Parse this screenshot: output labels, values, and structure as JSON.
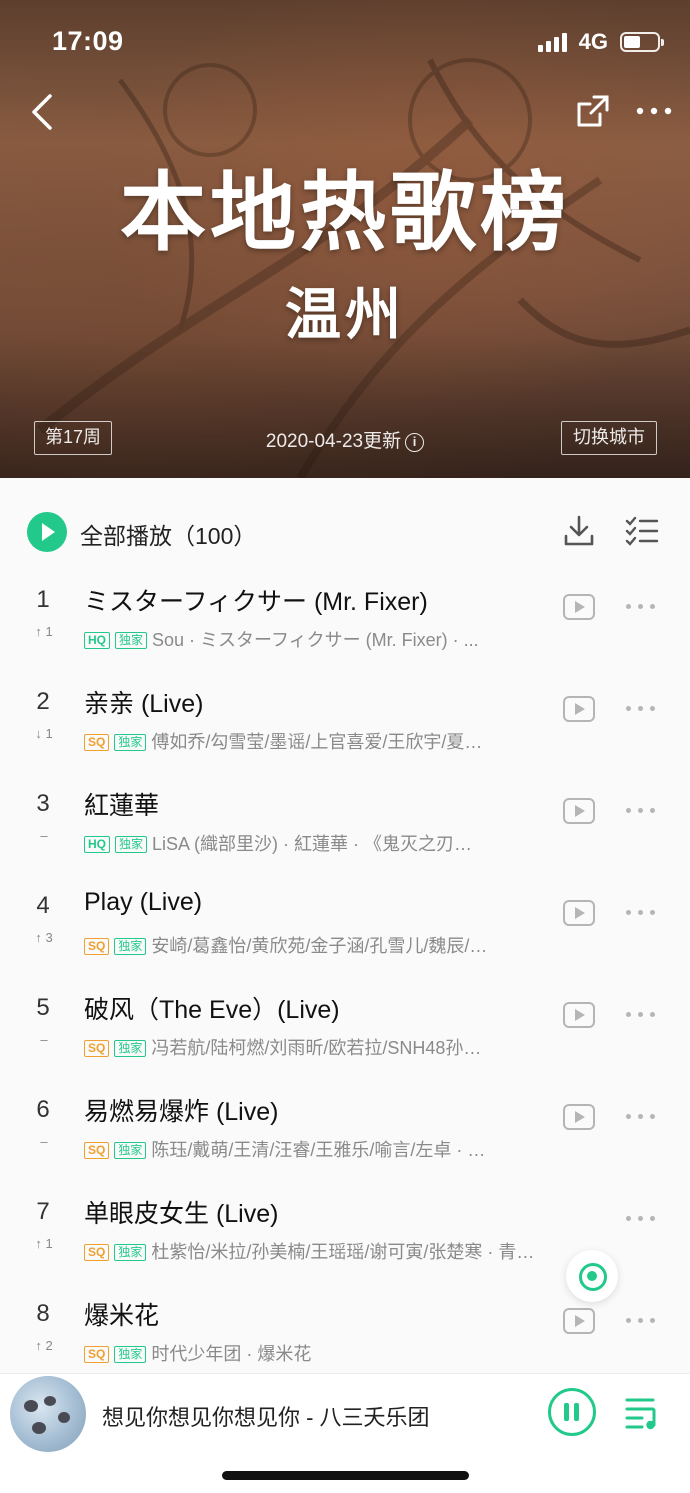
{
  "status_bar": {
    "time": "17:09",
    "network": "4G",
    "battery_level": 0.5
  },
  "header": {
    "title": "本地热歌榜",
    "city": "温州",
    "week": "第17周",
    "update_text": "2020-04-23更新",
    "info_glyph": "i",
    "switch_city": "切换城市",
    "icons": {
      "back": "back-arrow-icon",
      "share": "share-icon",
      "more": "more-dots-icon"
    }
  },
  "toolbar": {
    "play_all_label": "全部播放（100）",
    "icons": {
      "play_all": "play-circle-icon",
      "download": "download-icon",
      "multi_select": "checklist-icon"
    }
  },
  "songs": [
    {
      "rank": "1",
      "change": "↑ 1",
      "title": "ミスターフィクサー (Mr. Fixer)",
      "quality": "HQ",
      "exclusive": "独家",
      "meta": "Sou · ミスターフィクサー (Mr. Fixer) · ..."
    },
    {
      "rank": "2",
      "change": "↓ 1",
      "title": "亲亲 (Live)",
      "quality": "SQ",
      "exclusive": "独家",
      "meta": "傅如乔/勾雪莹/墨谣/上官喜爱/王欣宇/夏…"
    },
    {
      "rank": "3",
      "change": "–",
      "title": "紅蓮華",
      "quality": "HQ",
      "exclusive": "独家",
      "meta": "LiSA (織部里沙) · 紅蓮華 · 《鬼灭之刃…"
    },
    {
      "rank": "4",
      "change": "↑ 3",
      "title": "Play (Live)",
      "quality": "SQ",
      "exclusive": "独家",
      "meta": "安崎/葛鑫怡/黄欣苑/金子涵/孔雪儿/魏辰/…"
    },
    {
      "rank": "5",
      "change": "–",
      "title": "破风（The Eve）(Live)",
      "quality": "SQ",
      "exclusive": "独家",
      "meta": "冯若航/陆柯燃/刘雨昕/欧若拉/SNH48孙…"
    },
    {
      "rank": "6",
      "change": "–",
      "title": "易燃易爆炸 (Live)",
      "quality": "SQ",
      "exclusive": "独家",
      "meta": "陈珏/戴萌/王清/汪睿/王雅乐/喻言/左卓 · …"
    },
    {
      "rank": "7",
      "change": "↑ 1",
      "title": "单眼皮女生 (Live)",
      "quality": "SQ",
      "exclusive": "独家",
      "meta": "杜紫怡/米拉/孙美楠/王瑶瑶/谢可寅/张楚寒 · 青…"
    },
    {
      "rank": "8",
      "change": "↑ 2",
      "title": "爆米花",
      "quality": "SQ",
      "exclusive": "独家",
      "meta": "时代少年团 · 爆米花"
    }
  ],
  "row_icons": {
    "mv": "mv-play-icon",
    "more": "more-dots-icon"
  },
  "player": {
    "now_playing": "想见你想见你想见你 - 八三夭乐团",
    "icons": {
      "pause": "pause-circle-icon",
      "playlist": "playlist-icon",
      "locate": "locate-icon"
    }
  },
  "colors": {
    "accent": "#22c98a",
    "sq_badge": "#f0a030",
    "header_bg": "#7a513c"
  }
}
